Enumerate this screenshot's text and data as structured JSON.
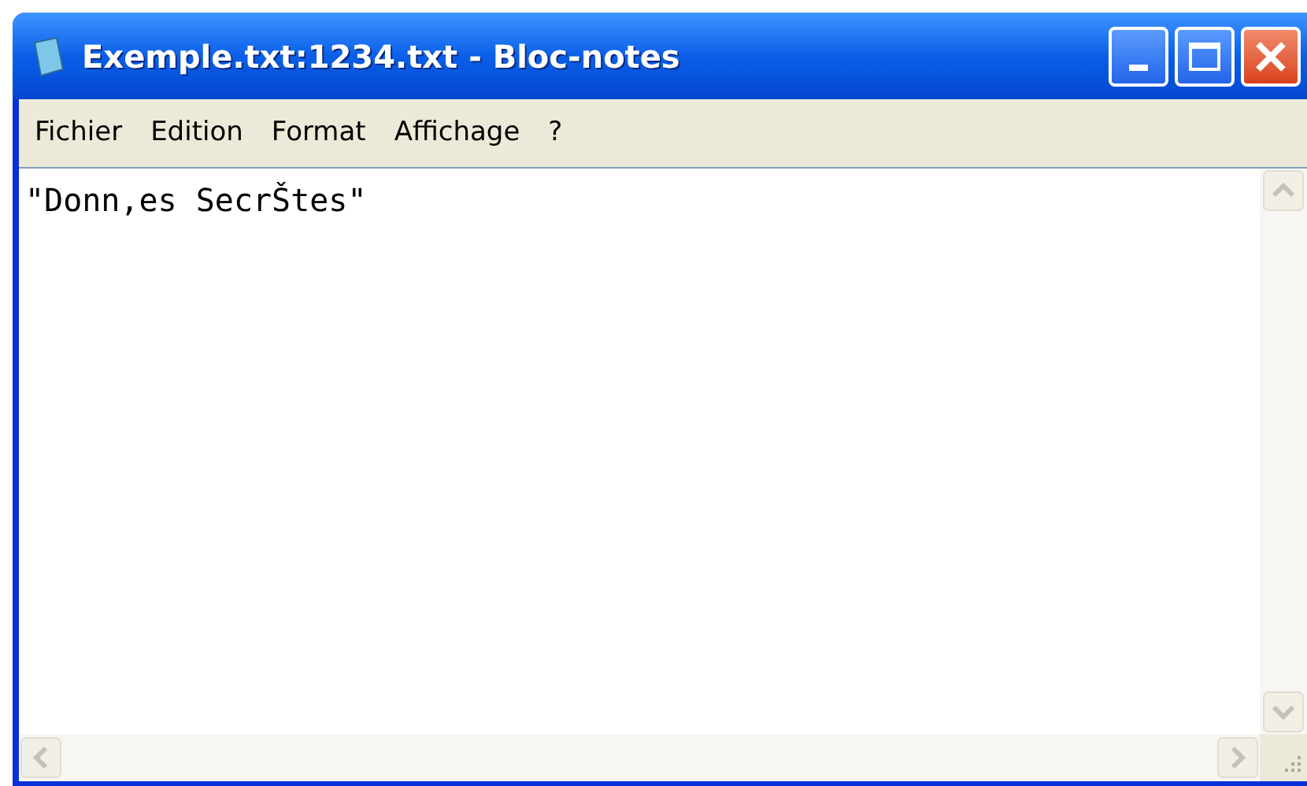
{
  "window": {
    "title": "Exemple.txt:1234.txt - Bloc-notes"
  },
  "menu": [
    {
      "label": "Fichier"
    },
    {
      "label": "Edition"
    },
    {
      "label": "Format"
    },
    {
      "label": "Affichage"
    },
    {
      "label": "?"
    }
  ],
  "editor": {
    "text": "\"Donn,es SecrŠtes\""
  }
}
